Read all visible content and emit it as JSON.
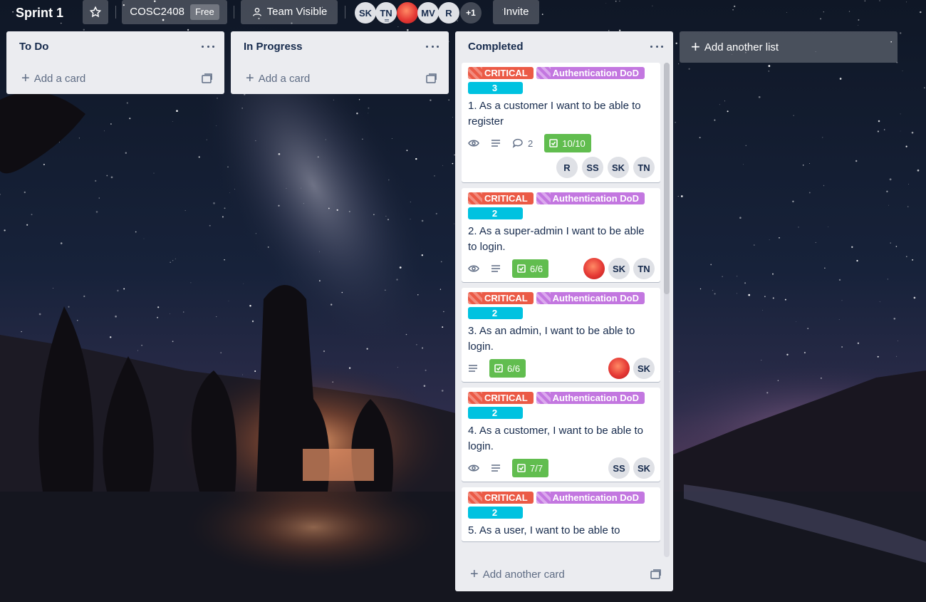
{
  "board": {
    "title": "Sprint 1",
    "workspace": "COSC2408",
    "plan_badge": "Free",
    "visibility": "Team Visible",
    "invite_label": "Invite",
    "members": [
      "SK",
      "TN",
      "",
      "MV",
      "R"
    ],
    "more_members": "+1"
  },
  "lists": [
    {
      "title": "To Do",
      "add_card_label": "Add a card"
    },
    {
      "title": "In Progress",
      "add_card_label": "Add a card"
    },
    {
      "title": "Completed",
      "add_card_label": "Add another card",
      "cards": [
        {
          "labels": {
            "priority": "CRITICAL",
            "category": "Authentication DoD",
            "points": "3"
          },
          "title": "1. As a customer I want to be able to register",
          "comments": "2",
          "checklist": "10/10",
          "members": [
            "R",
            "SS",
            "SK",
            "TN"
          ]
        },
        {
          "labels": {
            "priority": "CRITICAL",
            "category": "Authentication DoD",
            "points": "2"
          },
          "title": "2. As a super-admin I want to be able to login.",
          "checklist": "6/6",
          "members": [
            "",
            "SK",
            "TN"
          ]
        },
        {
          "labels": {
            "priority": "CRITICAL",
            "category": "Authentication DoD",
            "points": "2"
          },
          "title": "3. As an admin, I want to be able to login.",
          "checklist": "6/6",
          "members": [
            "",
            "SK"
          ]
        },
        {
          "labels": {
            "priority": "CRITICAL",
            "category": "Authentication DoD",
            "points": "2"
          },
          "title": "4. As a customer, I want to be able to login.",
          "checklist": "7/7",
          "members": [
            "SS",
            "SK"
          ]
        },
        {
          "labels": {
            "priority": "CRITICAL",
            "category": "Authentication DoD",
            "points": "2"
          },
          "title": "5. As a user, I want to be able to"
        }
      ]
    }
  ],
  "add_list_label": "Add another list",
  "colors": {
    "label_critical": "#eb5a46",
    "label_dod": "#c377e0",
    "label_points": "#00c2e0",
    "checklist_complete": "#61bd4f",
    "list_bg": "#ebecf0"
  }
}
